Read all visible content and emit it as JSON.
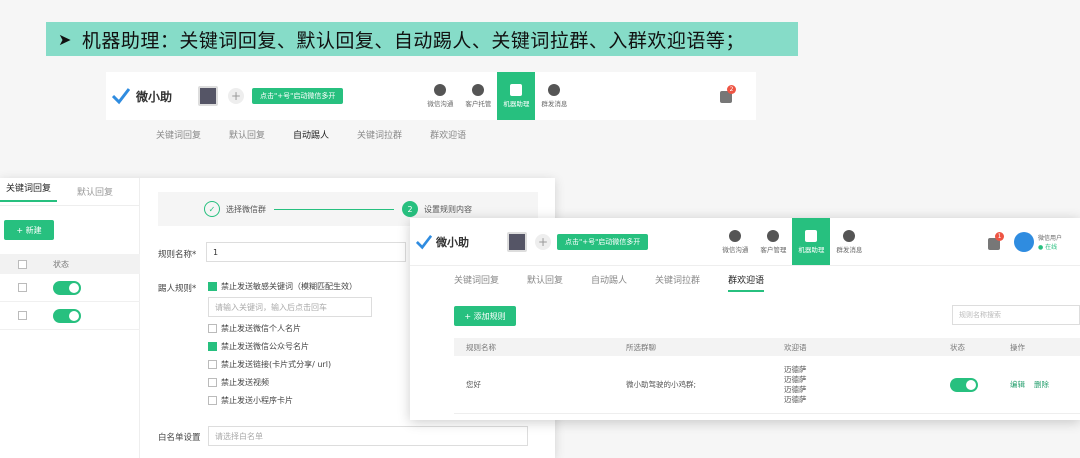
{
  "banner": {
    "arrow": "➤",
    "text": "机器助理：关键词回复、默认回复、自动踢人、关键词拉群、入群欢迎语等；"
  },
  "brand": {
    "name": "微小助",
    "accent": "#27c07f"
  },
  "back": {
    "pill": "点击\"+号\"启动微信多开",
    "nav": [
      "微信沟通",
      "客户托管",
      "机器助理",
      "群发消息"
    ],
    "active_nav": "机器助理",
    "bell_count": "2",
    "tabs": [
      "关键词回复",
      "默认回复",
      "自动踢人",
      "关键词拉群",
      "群欢迎语"
    ],
    "active_tab": "自动踢人"
  },
  "left": {
    "tabs": [
      "关键词回复",
      "默认回复"
    ],
    "new_button": "+ 新建",
    "status_header": "状态",
    "steps": [
      "选择微信群",
      "设置规则内容"
    ],
    "step2_num": "2",
    "rule_name_label": "规则名称*",
    "rule_name_value": "1",
    "kick_rule_label": "踢人规则*",
    "keyword_placeholder": "请输入关键词，输入后点击回车",
    "options": [
      {
        "label": "禁止发送敏感关键词（模糊匹配生效）",
        "checked": true
      },
      {
        "label": "禁止发送微信个人名片",
        "checked": false
      },
      {
        "label": "禁止发送微信公众号名片",
        "checked": true
      },
      {
        "label": "禁止发送链接(卡片式分享/ url)",
        "checked": false
      },
      {
        "label": "禁止发送视频",
        "checked": false
      },
      {
        "label": "禁止发送小程序卡片",
        "checked": false
      }
    ],
    "whitelist_label": "白名单设置",
    "whitelist_placeholder": "请选择白名单"
  },
  "front": {
    "pill": "点击\"+号\"启动微信多开",
    "nav": [
      "微信沟通",
      "客户管理",
      "机器助理",
      "群发消息"
    ],
    "bell_count": "1",
    "user_name": "微信用户",
    "user_status": "● 在线",
    "tabs": [
      "关键词回复",
      "默认回复",
      "自动踢人",
      "关键词拉群",
      "群欢迎语"
    ],
    "active_tab": "群欢迎语",
    "add_button": "+ 添加规则",
    "search_placeholder": "规则名称搜索",
    "columns": [
      "规则名称",
      "所选群聊",
      "欢迎语",
      "状态",
      "操作"
    ],
    "rows": [
      {
        "name": "您好",
        "group": "微小助驾驶的小鸡群;",
        "greetings": [
          "迈德萨",
          "迈德萨",
          "迈德萨",
          "迈德萨"
        ],
        "edit": "编辑",
        "delete": "删除"
      }
    ]
  }
}
